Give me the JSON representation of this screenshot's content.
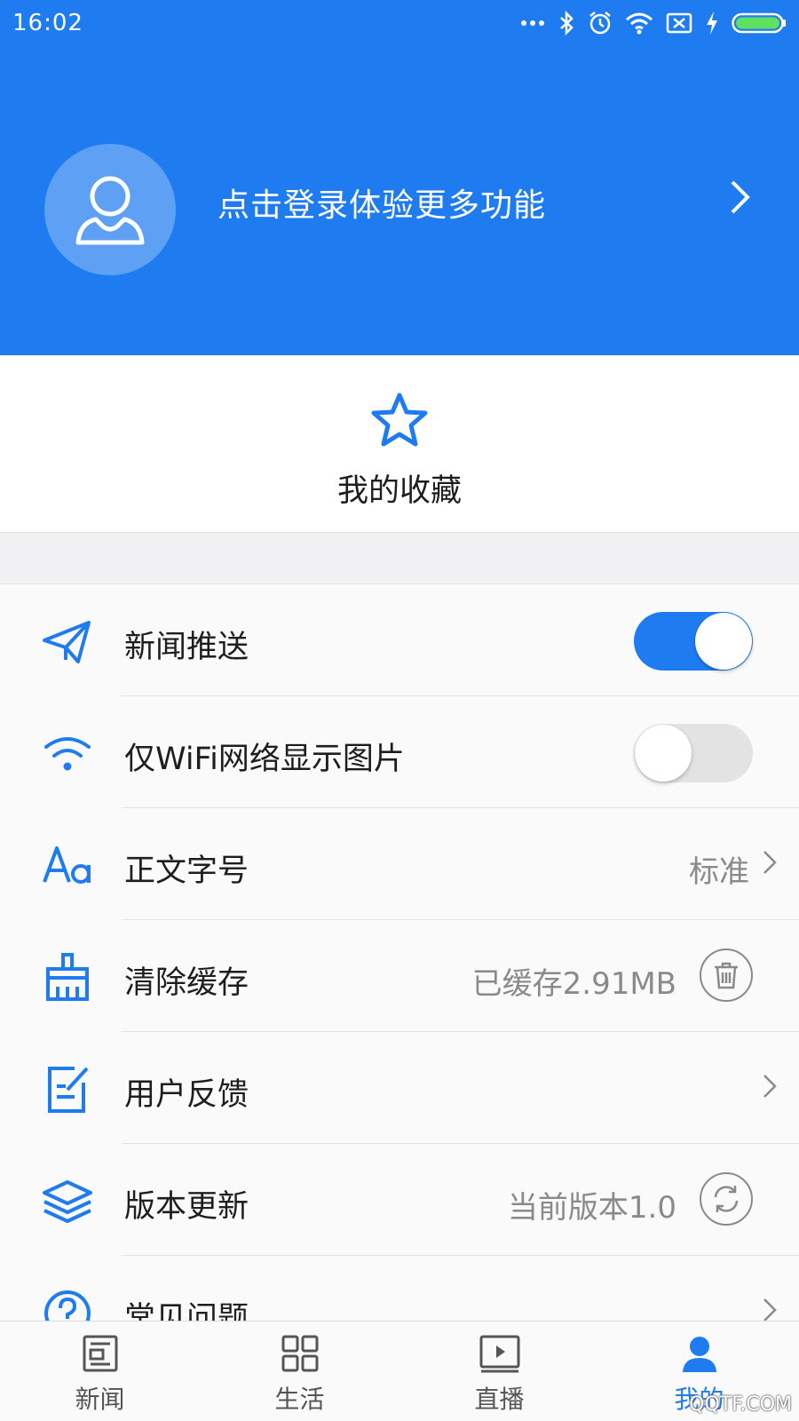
{
  "status_bar": {
    "time": "16:02"
  },
  "header": {
    "login_text": "点击登录体验更多功能"
  },
  "favorites": {
    "label": "我的收藏"
  },
  "settings": {
    "news_push": {
      "label": "新闻推送",
      "enabled": true
    },
    "wifi_images": {
      "label": "仅WiFi网络显示图片",
      "enabled": false
    },
    "font_size": {
      "label": "正文字号",
      "value": "标准"
    },
    "clear_cache": {
      "label": "清除缓存",
      "value": "已缓存2.91MB"
    },
    "feedback": {
      "label": "用户反馈"
    },
    "version": {
      "label": "版本更新",
      "value": "当前版本1.0"
    },
    "faq": {
      "label": "常见问题"
    }
  },
  "tabbar": {
    "tabs": [
      {
        "label": "新闻",
        "icon": "newspaper-icon"
      },
      {
        "label": "生活",
        "icon": "grid-icon"
      },
      {
        "label": "直播",
        "icon": "play-icon"
      },
      {
        "label": "我的",
        "icon": "user-icon"
      }
    ],
    "active_index": 3
  },
  "watermark": "QQTF.COM",
  "colors": {
    "accent": "#1f7cf0",
    "inactive": "#555555",
    "secondary_text": "#8a8a8a"
  }
}
